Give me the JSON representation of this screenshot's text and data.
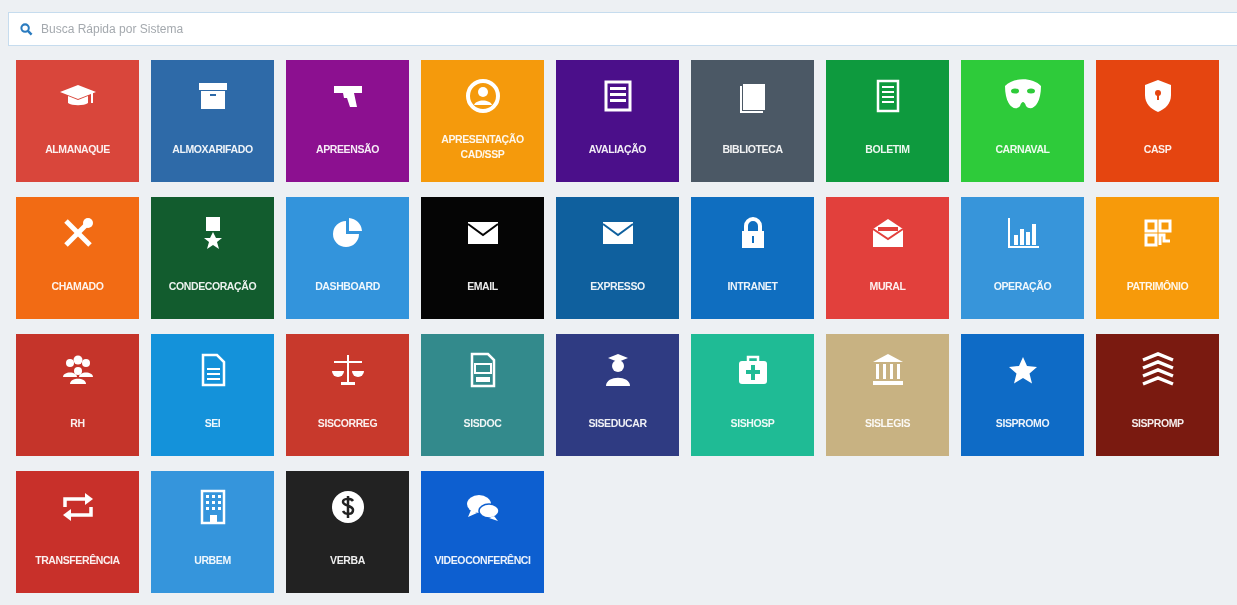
{
  "search": {
    "placeholder": "Busca Rápida por Sistema"
  },
  "tiles": [
    {
      "label": "ALMANAQUE",
      "color": "#d9463b"
    },
    {
      "label": "ALMOXARIFADO",
      "color": "#2e6aa8"
    },
    {
      "label": "APREENSÃO",
      "color": "#8c1090"
    },
    {
      "label": "APRESENTAÇÃO CAD/SSP",
      "color": "#f59a0c"
    },
    {
      "label": "AVALIAÇÃO",
      "color": "#4b0f8a"
    },
    {
      "label": "BIBLIOTECA",
      "color": "#4b5865"
    },
    {
      "label": "BOLETIM",
      "color": "#0e9a3e"
    },
    {
      "label": "CARNAVAL",
      "color": "#2ecb3a"
    },
    {
      "label": "CASP",
      "color": "#e54510"
    },
    {
      "label": "CHAMADO",
      "color": "#f26b14"
    },
    {
      "label": "CONDECORAÇÃO",
      "color": "#125c2e"
    },
    {
      "label": "DASHBOARD",
      "color": "#3394dc"
    },
    {
      "label": "EMAIL",
      "color": "#050505"
    },
    {
      "label": "EXPRESSO",
      "color": "#0f609e"
    },
    {
      "label": "INTRANET",
      "color": "#0f6ec0"
    },
    {
      "label": "MURAL",
      "color": "#e2403c"
    },
    {
      "label": "OPERAÇÃO",
      "color": "#3795da"
    },
    {
      "label": "PATRIMÔNIO",
      "color": "#f79a0a"
    },
    {
      "label": "RH",
      "color": "#c5342a"
    },
    {
      "label": "SEI",
      "color": "#1492da"
    },
    {
      "label": "SISCORREG",
      "color": "#c8392c"
    },
    {
      "label": "SISDOC",
      "color": "#338a8c"
    },
    {
      "label": "SISEDUCAR",
      "color": "#2f3b82"
    },
    {
      "label": "SISHOSP",
      "color": "#1fbb95"
    },
    {
      "label": "SISLEGIS",
      "color": "#c8b282"
    },
    {
      "label": "SISPROMO",
      "color": "#0e6bc6"
    },
    {
      "label": "SISPROMP",
      "color": "#7a1a10"
    },
    {
      "label": "TRANSFERÊNCIA",
      "color": "#c8302a"
    },
    {
      "label": "URBEM",
      "color": "#3595dc"
    },
    {
      "label": "VERBA",
      "color": "#222222"
    },
    {
      "label": "VIDEOCONFERÊNCI",
      "color": "#0d5fd0"
    }
  ]
}
